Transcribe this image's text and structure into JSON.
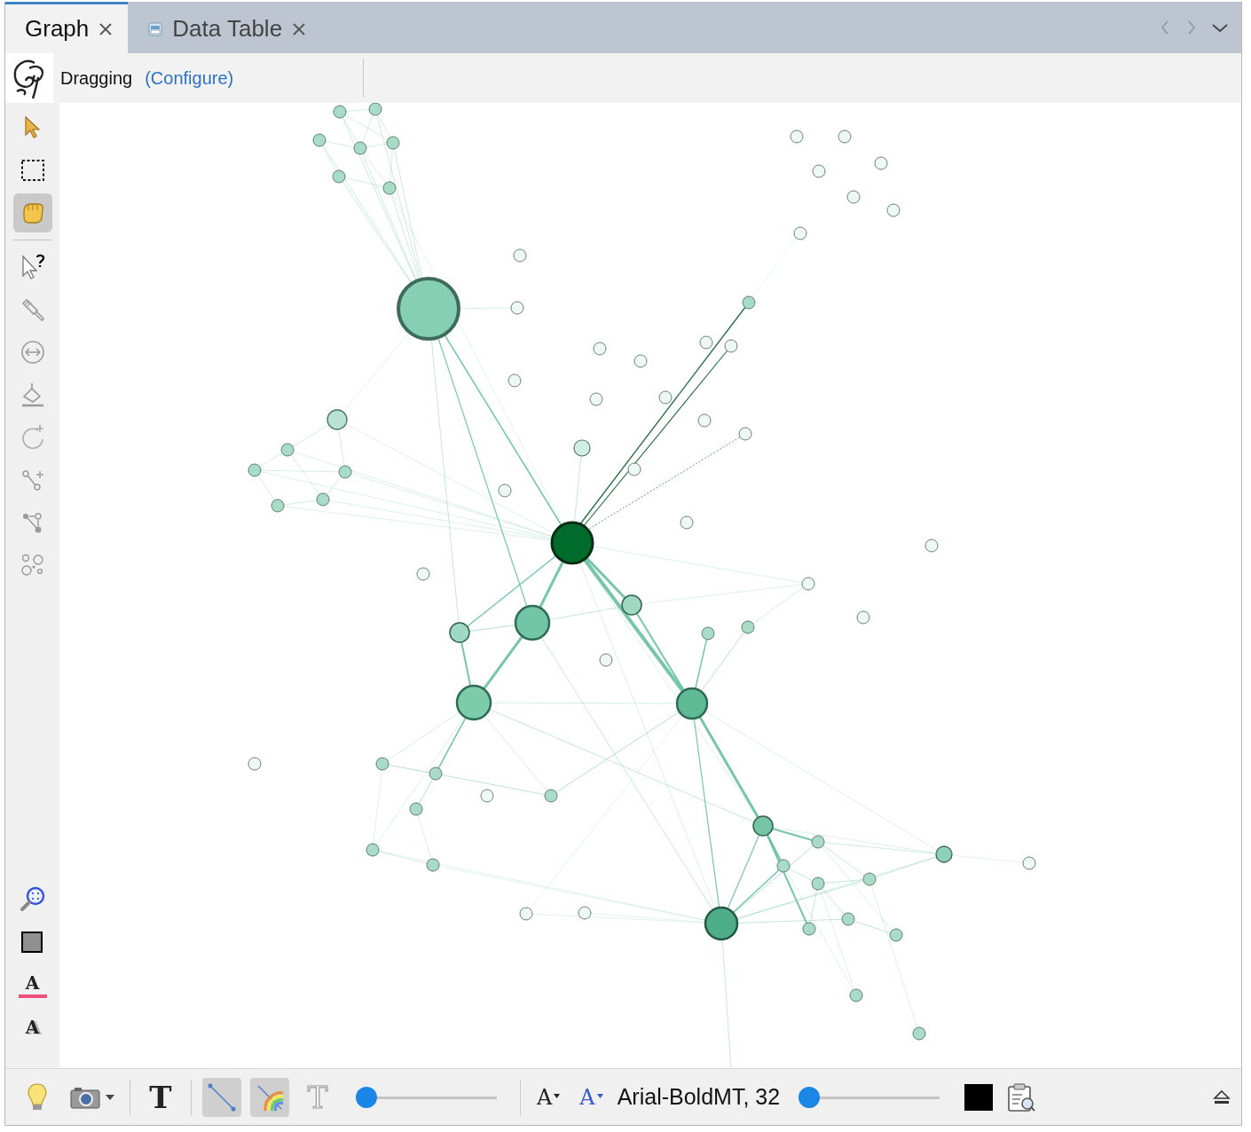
{
  "tabs": [
    {
      "label": "Graph",
      "selected": true,
      "icon": false
    },
    {
      "label": "Data Table",
      "selected": false,
      "icon": true
    }
  ],
  "tool_bar": {
    "mode": "Dragging",
    "link": "(Configure)"
  },
  "tools": [
    {
      "kind": "select",
      "selected": false
    },
    {
      "kind": "rectangle",
      "selected": false
    },
    {
      "kind": "drag",
      "selected": true
    },
    {
      "kind": "separator"
    },
    {
      "kind": "info",
      "selected": false
    },
    {
      "kind": "brush",
      "selected": false
    },
    {
      "kind": "size",
      "selected": false
    },
    {
      "kind": "bucket",
      "selected": false
    },
    {
      "kind": "add-node",
      "selected": false
    },
    {
      "kind": "add-edge",
      "selected": false
    },
    {
      "kind": "path",
      "selected": false
    },
    {
      "kind": "clusters",
      "selected": false
    }
  ],
  "side_bottom": [
    {
      "kind": "zoom"
    },
    {
      "kind": "background"
    },
    {
      "kind": "label-color",
      "glyph": "A"
    },
    {
      "kind": "label-size",
      "glyph": "A"
    }
  ],
  "bottom_bar": [
    {
      "kind": "bulb"
    },
    {
      "kind": "camera"
    },
    {
      "kind": "separator"
    },
    {
      "kind": "label-toggle",
      "glyph": "T",
      "pressed": false
    },
    {
      "kind": "separator"
    },
    {
      "kind": "edge-toggle",
      "pressed": true
    },
    {
      "kind": "edge-color-toggle",
      "pressed": true
    },
    {
      "kind": "edge-label-toggle",
      "glyph": "T",
      "pressed": false
    },
    {
      "kind": "slider",
      "level": 0.07
    },
    {
      "kind": "separator"
    },
    {
      "kind": "font-size",
      "glyph": "A"
    },
    {
      "kind": "font-color",
      "glyph": "A"
    },
    {
      "kind": "font-name",
      "label": "Arial-BoldMT, 32"
    },
    {
      "kind": "slider",
      "level": 0.07
    },
    {
      "kind": "swatch"
    },
    {
      "kind": "clipboard"
    },
    {
      "kind": "spacer"
    },
    {
      "kind": "eject"
    }
  ]
}
